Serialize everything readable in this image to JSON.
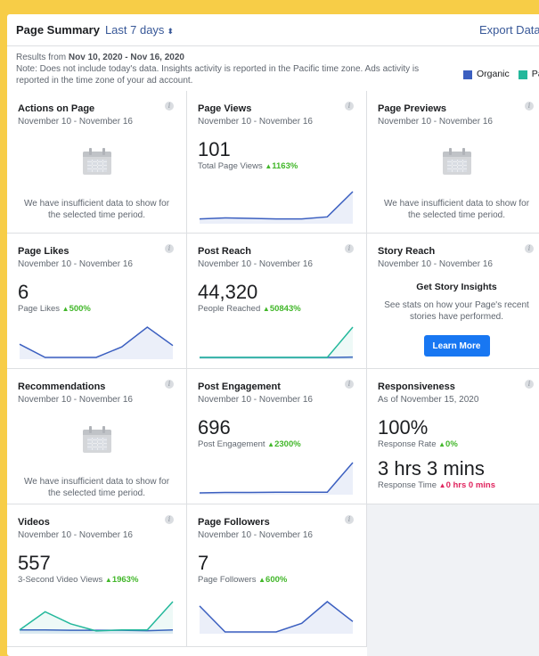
{
  "header": {
    "title": "Page Summary",
    "range": "Last 7 days",
    "export": "Export Data"
  },
  "notes": {
    "prefix": "Results from ",
    "range": "Nov 10, 2020 - Nov 16, 2020",
    "note": "Note: Does not include today's data. Insights activity is reported in the Pacific time zone. Ads activity is reported in the time zone of your ad account."
  },
  "legend": {
    "organic": "Organic",
    "paid": "Paid",
    "organic_color": "#3b5fc0",
    "paid_color": "#23b89b"
  },
  "insufficient_text": "We have insufficient data to show for the selected time period.",
  "cards": {
    "actions": {
      "title": "Actions on Page",
      "date": "November 10 - November 16"
    },
    "page_views": {
      "title": "Page Views",
      "date": "November 10 - November 16",
      "value": "101",
      "label": "Total Page Views",
      "delta": "1163%",
      "organic": [
        3,
        4,
        3.5,
        3,
        3,
        5,
        30
      ],
      "paid": []
    },
    "previews": {
      "title": "Page Previews",
      "date": "November 10 - November 16"
    },
    "likes": {
      "title": "Page Likes",
      "date": "November 10 - November 16",
      "value": "6",
      "label": "Page Likes",
      "delta": "500%",
      "organic": [
        1,
        0,
        0,
        0,
        0.8,
        2.3,
        0.9
      ],
      "paid": []
    },
    "post_reach": {
      "title": "Post Reach",
      "date": "November 10 - November 16",
      "value": "44,320",
      "label": "People Reached",
      "delta": "50843%",
      "organic": [
        0,
        0,
        0,
        0,
        0,
        0,
        0.3
      ],
      "paid": [
        0,
        0,
        0,
        0,
        0,
        0,
        29
      ]
    },
    "story_reach": {
      "title": "Story Reach",
      "date": "November 10 - November 16",
      "heading": "Get Story Insights",
      "text": "See stats on how your Page's recent stories have performed.",
      "button": "Learn More"
    },
    "recommendations": {
      "title": "Recommendations",
      "date": "November 10 - November 16"
    },
    "engagement": {
      "title": "Post Engagement",
      "date": "November 10 - November 16",
      "value": "696",
      "label": "Post Engagement",
      "delta": "2300%",
      "organic": [
        0,
        0.3,
        0.3,
        0.5,
        0.5,
        0.5,
        21
      ],
      "paid": []
    },
    "responsiveness": {
      "title": "Responsiveness",
      "date": "As of November 15, 2020",
      "rate_value": "100%",
      "rate_label": "Response Rate",
      "rate_delta": "0%",
      "time_value": "3 hrs 3 mins",
      "time_label": "Response Time",
      "time_delta": "0 hrs 0 mins"
    },
    "videos": {
      "title": "Videos",
      "date": "November 10 - November 16",
      "value": "557",
      "label": "3-Second Video Views",
      "delta": "1963%",
      "organic": [
        1,
        1,
        0.8,
        0.8,
        0.8,
        0.6,
        1
      ],
      "paid": [
        1,
        10,
        4,
        0.5,
        1,
        1,
        15
      ]
    },
    "followers": {
      "title": "Page Followers",
      "date": "November 10 - November 16",
      "value": "7",
      "label": "Page Followers",
      "delta": "600%",
      "organic": [
        3,
        0,
        0,
        0,
        1,
        3.5,
        1.2
      ],
      "paid": []
    }
  }
}
